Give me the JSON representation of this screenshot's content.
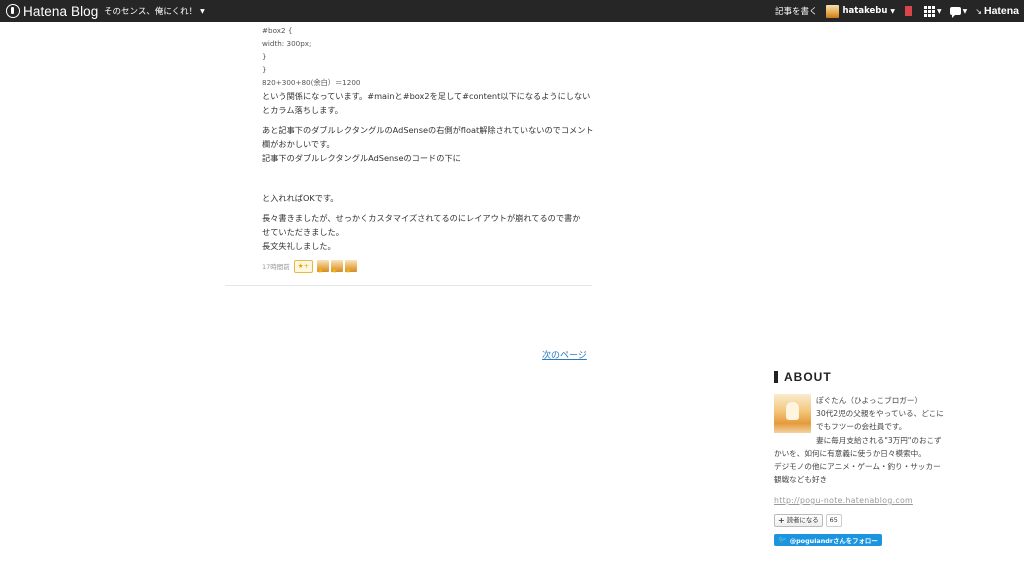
{
  "header": {
    "brand": "Hatena Blog",
    "blog_title": "そのセンス、俺にくれ！",
    "write_link": "記事を書く",
    "username": "hatakebu",
    "hatena_logo": "Hatena",
    "icons": [
      "bookmark-icon",
      "apps-icon",
      "comment-icon"
    ]
  },
  "article": {
    "code_lines": [
      "#box2 {",
      "width: 300px;",
      "}",
      "}",
      "820+300+80(余白）＝1200"
    ],
    "para1_lines": [
      "という関係になっています。#mainと#box2を足して#content以下になるようにしない",
      "とカラム落ちします。"
    ],
    "para2_lines": [
      "あと記事下のダブルレクタングルのAdSenseの右側がfloat解除されていないのでコメント",
      "欄がおかしいです。",
      "記事下のダブルレクタングルAdSenseのコードの下に"
    ],
    "para3": "と入れればOKです。",
    "para4_lines": [
      "長々書きましたが、せっかくカスタマイズされてるのにレイアウトが崩れてるので書か",
      "せていただきました。",
      "長文失礼しました。"
    ],
    "time": "17時間前",
    "star_add_label": "★+",
    "next_page": "次のページ"
  },
  "sidebar": {
    "about_title": "ABOUT",
    "profile_lines": [
      "ぽぐたん（ひよっこブロガー）",
      "30代2児の父親をやっている、どこに",
      "でもフツーの会社員です。",
      "妻に毎月支給される\"3万円\"のおこず",
      "かいを、如何に有意義に使うか日々模索中。",
      "デジモノの他にアニメ・ゲーム・釣り・サッカー",
      "観戦なども好き"
    ],
    "url": "http://pogu-note.hatenablog.com",
    "reader_label": "読者になる",
    "reader_count": "65",
    "twitter_label": "@pogulandrさんをフォロー"
  }
}
